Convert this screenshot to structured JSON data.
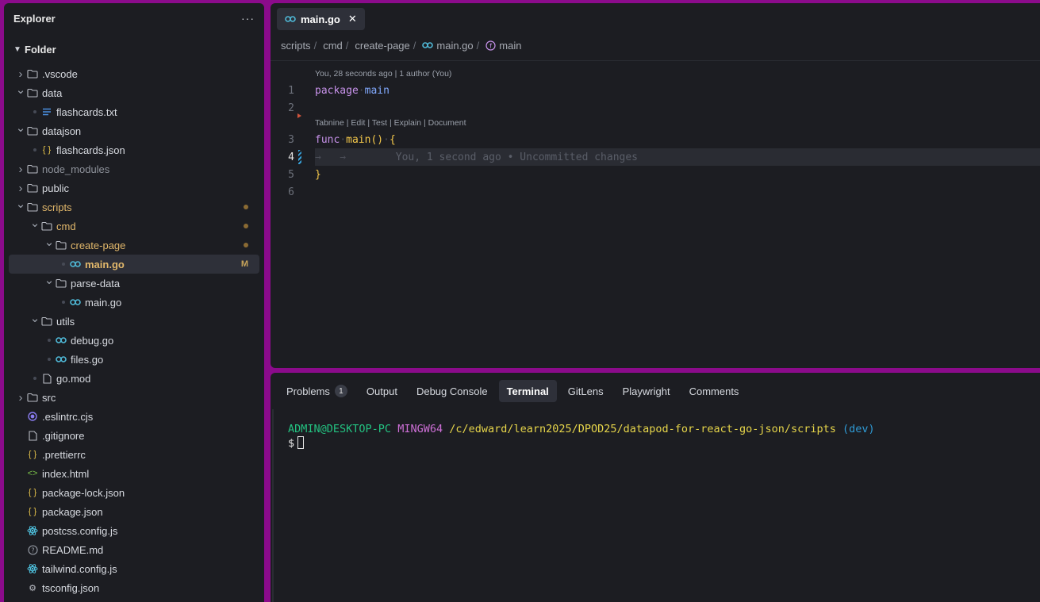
{
  "explorer": {
    "title": "Explorer",
    "more_label": "···",
    "root_label": "Folder",
    "items": [
      {
        "label": ".vscode",
        "depth": 0,
        "type": "folder",
        "state": "collapsed",
        "color": "norm"
      },
      {
        "label": "data",
        "depth": 0,
        "type": "folder",
        "state": "expanded",
        "color": "norm"
      },
      {
        "label": "flashcards.txt",
        "depth": 1,
        "type": "txt",
        "color": "norm"
      },
      {
        "label": "datajson",
        "depth": 0,
        "type": "folder",
        "state": "expanded",
        "color": "norm"
      },
      {
        "label": "flashcards.json",
        "depth": 1,
        "type": "json",
        "color": "norm"
      },
      {
        "label": "node_modules",
        "depth": 0,
        "type": "folder",
        "state": "collapsed",
        "color": "dim"
      },
      {
        "label": "public",
        "depth": 0,
        "type": "folder",
        "state": "collapsed",
        "color": "norm"
      },
      {
        "label": "scripts",
        "depth": 0,
        "type": "folder",
        "state": "expanded",
        "color": "mod",
        "dot": true
      },
      {
        "label": "cmd",
        "depth": 1,
        "type": "folder",
        "state": "expanded",
        "color": "mod",
        "dot": true
      },
      {
        "label": "create-page",
        "depth": 2,
        "type": "folder",
        "state": "expanded",
        "color": "mod",
        "dot": true
      },
      {
        "label": "main.go",
        "depth": 3,
        "type": "go",
        "color": "mod",
        "badge": "M",
        "selected": true
      },
      {
        "label": "parse-data",
        "depth": 2,
        "type": "folder",
        "state": "expanded",
        "color": "norm"
      },
      {
        "label": "main.go",
        "depth": 3,
        "type": "go",
        "color": "norm"
      },
      {
        "label": "utils",
        "depth": 1,
        "type": "folder",
        "state": "expanded",
        "color": "norm"
      },
      {
        "label": "debug.go",
        "depth": 2,
        "type": "go",
        "color": "norm"
      },
      {
        "label": "files.go",
        "depth": 2,
        "type": "go",
        "color": "norm"
      },
      {
        "label": "go.mod",
        "depth": 1,
        "type": "file",
        "color": "norm"
      },
      {
        "label": "src",
        "depth": 0,
        "type": "folder",
        "state": "collapsed",
        "color": "norm"
      },
      {
        "label": ".eslintrc.cjs",
        "depth": 0,
        "type": "eslint",
        "color": "norm"
      },
      {
        "label": ".gitignore",
        "depth": 0,
        "type": "file",
        "color": "norm"
      },
      {
        "label": ".prettierrc",
        "depth": 0,
        "type": "json",
        "color": "norm"
      },
      {
        "label": "index.html",
        "depth": 0,
        "type": "html",
        "color": "norm"
      },
      {
        "label": "package-lock.json",
        "depth": 0,
        "type": "json",
        "color": "norm"
      },
      {
        "label": "package.json",
        "depth": 0,
        "type": "json",
        "color": "norm"
      },
      {
        "label": "postcss.config.js",
        "depth": 0,
        "type": "react",
        "color": "norm"
      },
      {
        "label": "README.md",
        "depth": 0,
        "type": "info",
        "color": "norm"
      },
      {
        "label": "tailwind.config.js",
        "depth": 0,
        "type": "react",
        "color": "norm"
      },
      {
        "label": "tsconfig.json",
        "depth": 0,
        "type": "gear",
        "color": "norm"
      }
    ]
  },
  "editor": {
    "tab_label": "main.go",
    "tab_close": "✕",
    "breadcrumb": {
      "scripts": "scripts",
      "cmd": "cmd",
      "create_page": "create-page",
      "file": "main.go",
      "symbol": "main",
      "sep": "/"
    },
    "codelens_1": "You, 28 seconds ago | 1 author (You)",
    "codelens_2": "Tabnine | Edit | Test | Explain | Document",
    "lines": [
      {
        "n": "1",
        "kw": "package",
        "ws": "·",
        "rest": "main"
      },
      {
        "n": "2"
      },
      {
        "n": "3",
        "kw": "func",
        "ws": "·",
        "fn": "main",
        "paren": "()",
        "ws2": "·",
        "brace": "{"
      },
      {
        "n": "4",
        "tabs": "→   →",
        "blame": "You, 1 second ago • Uncommitted changes"
      },
      {
        "n": "5",
        "brace": "}"
      },
      {
        "n": "6"
      }
    ]
  },
  "panel": {
    "tabs": [
      "Problems",
      "Output",
      "Debug Console",
      "Terminal",
      "GitLens",
      "Playwright",
      "Comments"
    ],
    "active_tab": "Terminal",
    "problems_count": "1",
    "terminal": {
      "user": "ADMIN@DESKTOP-PC",
      "env": "MINGW64",
      "path": "/c/edward/learn2025/DPOD25/datapod-for-react-go-json/scripts",
      "branch": "(dev)",
      "prompt": "$"
    }
  },
  "colors": {
    "frame": "#8b0b8b",
    "panel_bg": "#1c1d22",
    "modified": "#e2b86b",
    "go_icon": "#4fb8d6"
  }
}
